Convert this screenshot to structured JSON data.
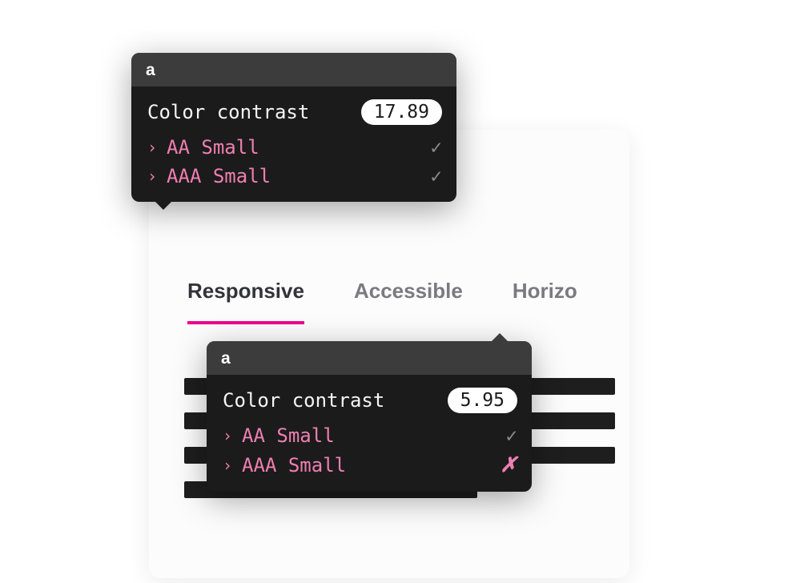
{
  "tabs": {
    "items": [
      {
        "label": "Responsive",
        "active": true
      },
      {
        "label": "Accessible",
        "active": false
      },
      {
        "label": "Horizo",
        "active": false
      }
    ]
  },
  "tooltip1": {
    "header": "a",
    "contrast_label": "Color contrast",
    "contrast_value": "17.89",
    "criteria": [
      {
        "label": "AA Small",
        "pass": true
      },
      {
        "label": "AAA Small",
        "pass": true
      }
    ]
  },
  "tooltip2": {
    "header": "a",
    "contrast_label": "Color contrast",
    "contrast_value": "5.95",
    "criteria": [
      {
        "label": "AA Small",
        "pass": true
      },
      {
        "label": "AAA Small",
        "pass": false
      }
    ]
  },
  "icons": {
    "chevron": "›",
    "check": "✓",
    "cross": "✗"
  }
}
